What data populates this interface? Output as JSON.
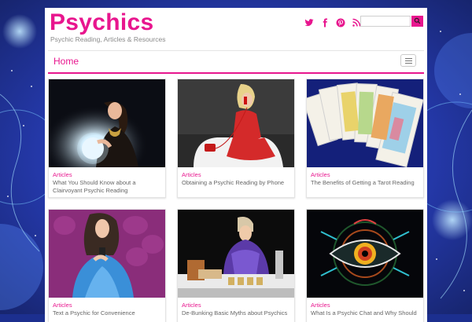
{
  "site": {
    "name": "Psychics",
    "tagline": "Psychic Reading, Articles & Resources"
  },
  "social": [
    {
      "icon": "twitter-icon"
    },
    {
      "icon": "facebook-icon"
    },
    {
      "icon": "pinterest-icon"
    },
    {
      "icon": "rss-icon"
    }
  ],
  "search": {
    "value": "",
    "placeholder": ""
  },
  "nav": {
    "home_label": "Home"
  },
  "colors": {
    "accent": "#e8168e",
    "text": "#666666",
    "background": "#1c2f8f"
  },
  "articles": [
    {
      "category": "Articles",
      "title": "What You Should Know about a Clairvoyant Psychic Reading",
      "image": "woman-with-crystal-ball"
    },
    {
      "category": "Articles",
      "title": "Obtaining a Psychic Reading by Phone",
      "image": "woman-on-red-phone"
    },
    {
      "category": "Articles",
      "title": "The Benefits of Getting a Tarot Reading",
      "image": "tarot-cards"
    },
    {
      "category": "Articles",
      "title": "Text a Psychic for Convenience",
      "image": "woman-texting"
    },
    {
      "category": "Articles",
      "title": "De-Bunking Basic Myths about Psychics",
      "image": "fortune-teller-table"
    },
    {
      "category": "Articles",
      "title": "What Is a Psychic Chat and Why Should",
      "image": "mystic-eye"
    }
  ]
}
